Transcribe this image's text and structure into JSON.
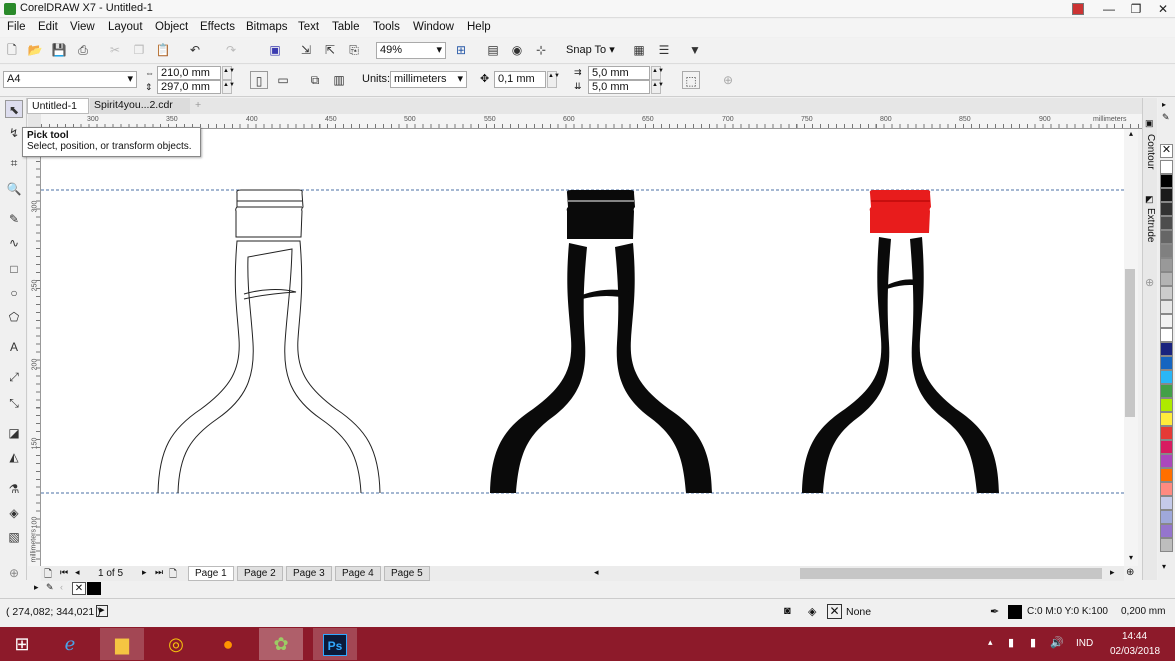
{
  "window": {
    "title": "CorelDRAW X7 - Untitled-1",
    "min": "—",
    "restore": "❐",
    "close": "✕"
  },
  "menu": [
    "File",
    "Edit",
    "View",
    "Layout",
    "Object",
    "Effects",
    "Bitmaps",
    "Text",
    "Table",
    "Tools",
    "Window",
    "Help"
  ],
  "toolbar": {
    "zoom": "49%",
    "snap_to": "Snap To"
  },
  "property_bar": {
    "page_size": "A4",
    "width": "210,0 mm",
    "height": "297,0 mm",
    "units_label": "Units:",
    "units_value": "millimeters",
    "nudge": "0,1 mm",
    "dup_x": "5,0 mm",
    "dup_y": "5,0 mm"
  },
  "doc_tabs": [
    "Untitled-1",
    "Spirit4you...2.cdr"
  ],
  "ruler": {
    "h_labels": [
      "300",
      "350",
      "400",
      "450",
      "500",
      "550",
      "600",
      "650",
      "700",
      "750",
      "800",
      "850",
      "900"
    ],
    "h_unit": "millimeters",
    "v_labels": [
      "300",
      "250",
      "200",
      "150",
      "100"
    ],
    "v_unit": "millimeters"
  },
  "tooltip": {
    "title": "Pick tool",
    "text": "Select, position, or transform objects."
  },
  "pages": {
    "counter": "1 of 5",
    "tabs": [
      "Page 1",
      "Page 2",
      "Page 3",
      "Page 4",
      "Page 5"
    ]
  },
  "dockers": {
    "contour": "Contour",
    "extrude": "Extrude"
  },
  "status": {
    "coords": "( 274,082; 344,021 )",
    "fill_label": "None",
    "outline_color": "C:0 M:0 Y:0 K:100",
    "outline_width": "0,200 mm"
  },
  "taskbar": {
    "lang": "IND",
    "time": "14:44",
    "date": "02/03/2018"
  },
  "colors": {
    "bottle_black": "#0a0a0a",
    "cap_red": "#e81c1c",
    "guide": "#4a6fa5",
    "taskbar": "#8d1a2a",
    "palette": [
      "#ffffff",
      "#000000",
      "#1a1a1a",
      "#333333",
      "#4d4d4d",
      "#666666",
      "#808080",
      "#999999",
      "#b3b3b3",
      "#cccccc",
      "#e6e6e6",
      "#f2f2f2",
      "#ffffff",
      "#1a237e",
      "#1565c0",
      "#29b6f6",
      "#43a047",
      "#aeea00",
      "#ffeb3b",
      "#e53935",
      "#d81b60",
      "#ab47bc",
      "#ff6f00",
      "#ff8a80",
      "#c5cae9",
      "#9fa8da",
      "#9575cd",
      "#bdbdbd"
    ]
  }
}
